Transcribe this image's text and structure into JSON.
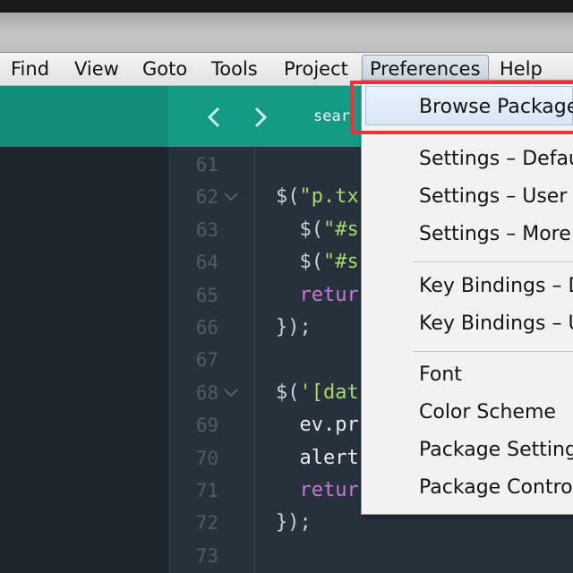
{
  "menubar": {
    "items": [
      {
        "label": "Find"
      },
      {
        "label": "View"
      },
      {
        "label": "Goto"
      },
      {
        "label": "Tools"
      },
      {
        "label": "Project"
      },
      {
        "label": "Preferences"
      },
      {
        "label": "Help"
      }
    ]
  },
  "tabbar": {
    "tab_label": "sear"
  },
  "editor": {
    "line_numbers": [
      "61",
      "62",
      "63",
      "64",
      "65",
      "66",
      "67",
      "68",
      "69",
      "70",
      "71",
      "72",
      "73"
    ],
    "lines": {
      "l62": {
        "a": "$(",
        "b": "\"p.tx"
      },
      "l63": {
        "a": "  $(",
        "b": "\"#s"
      },
      "l64": {
        "a": "  $(",
        "b": "\"#s"
      },
      "l65": {
        "a": "  ",
        "b": "retur"
      },
      "l66": {
        "a": "});"
      },
      "l68": {
        "a": "$(",
        "b": "'[dat"
      },
      "l69": {
        "a": "  ev.pr"
      },
      "l70": {
        "a": "  alert"
      },
      "l71": {
        "a": "  ",
        "b": "retur"
      },
      "l72": {
        "a": "});"
      }
    }
  },
  "dropdown": {
    "items": [
      "Browse Packages",
      "Settings – Defau",
      "Settings – User",
      "Settings – More",
      "Key Bindings – D",
      "Key Bindings – U",
      "Font",
      "Color Scheme",
      "Package Settings",
      "Package Control"
    ]
  },
  "colors": {
    "accent_tab": "#159a86",
    "highlight": "#e8323c"
  }
}
